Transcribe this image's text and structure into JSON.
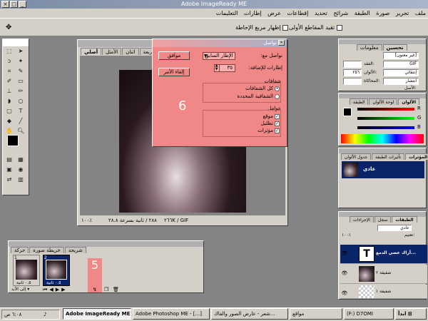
{
  "app": {
    "title": "Adobe ImageReady ME"
  },
  "menu": [
    "ملف",
    "تحرير",
    "صورة",
    "الطبقة",
    "شرائح",
    "تحديد",
    "إقطاعات",
    "عرض",
    "إطارات",
    "التعليمات"
  ],
  "options": {
    "constrain_label": "تقيد المقاطع الأولى",
    "transform_label": "إظهار مربع الإحاطة"
  },
  "document": {
    "tabs": [
      "أصلي",
      "الأمثل",
      "اثنان",
      "أربعة"
    ],
    "status": {
      "zoom": "١٠٠٪",
      "speed": "٢٨٨ / ثانية بسرعة ٢٨.٨",
      "size": "٢٦٦K / GIF"
    }
  },
  "dialog": {
    "title": "تواصل",
    "tween_with_label": "تواصل مع:",
    "tween_with_value": "الإطار السابق",
    "frames_to_add_label": "إطارات للإضافة:",
    "frames_to_add_value": "٣٥",
    "ok": "موافق",
    "cancel": "إلغاء الأمر",
    "layers_group": "شفافات",
    "layers_options": [
      "كل الشفافات",
      "الشفافية المحددة"
    ],
    "params_group": "عوامل",
    "params": [
      "موقع",
      "تظليل",
      "مؤثرات"
    ],
    "annotation": "6"
  },
  "animation": {
    "tabs": [
      "حركة",
      "خريطة صورة",
      "شريحة"
    ],
    "frames": [
      {
        "num": "1",
        "delay": "٠.٥ ثانية"
      },
      {
        "num": "2",
        "delay": "٠.٥ ثانية"
      }
    ],
    "loop": "إلى الأبد",
    "annotation": "5"
  },
  "optimize": {
    "tabs": [
      "معلومات",
      "تحسين"
    ],
    "format": "GIF",
    "preset": "[غير معنون]",
    "reduction": "إنتقائي",
    "colors": "٢٥٦",
    "dither_method": "انتشار",
    "lossy_label": "الفقد:",
    "colors_label": "الألوان:",
    "dither_label": "المحاكاة:",
    "matte_label": "الأصل:"
  },
  "color": {
    "tabs": [
      "الألوان",
      "لوحة الألوان",
      "الطبقة"
    ],
    "labels": [
      "R",
      "G",
      "B"
    ]
  },
  "styles": {
    "tabs": [
      "المؤثرات",
      "تأثيرات الطبقة",
      "جدول الألوان"
    ],
    "item": "عادي"
  },
  "layers": {
    "tabs": [
      "الطبقات",
      "سجل",
      "الإجراءات"
    ],
    "blend": "عادي",
    "opacity_label": "تعتيم:",
    "opacity": "١٠٠٪",
    "items": [
      {
        "name": "أراك عصي الدمع..."
      },
      {
        "name": "شفيفة ٢"
      },
      {
        "name": "شفيفة ١"
      }
    ]
  },
  "taskbar": {
    "start": "ابدأ",
    "items": [
      "Adobe ImageReady ME",
      "Adobe Photoshop ME - [...]",
      "شعر - عارض الصور والفاك...",
      "(F:) D7OMI",
      "مواقع"
    ],
    "clock": "٦:٠٨ ص"
  },
  "colors": {
    "dialog_bg": "#f08888",
    "annotation": "#ffffff",
    "anim_highlight": "#f08888",
    "layer_selected": "#0a246a"
  }
}
